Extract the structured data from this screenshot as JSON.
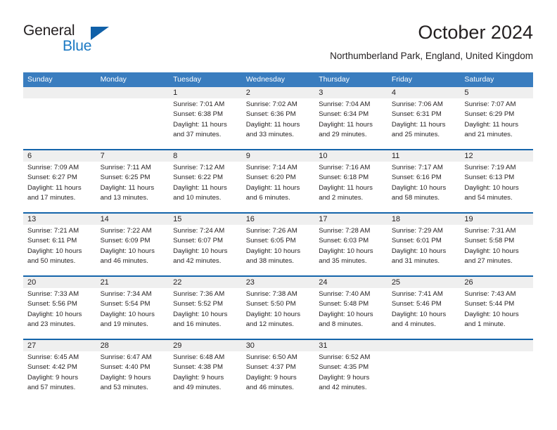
{
  "brand": {
    "name_part1": "General",
    "name_part2": "Blue",
    "accent_color": "#1b79c3",
    "triangle_color": "#1060a8"
  },
  "header": {
    "month_title": "October 2024",
    "location": "Northumberland Park, England, United Kingdom"
  },
  "theme": {
    "header_row_bg": "#3a7dbf",
    "week_separator": "#1565ab",
    "daynum_band_bg": "#efefef",
    "text_color": "#231f20"
  },
  "calendar": {
    "day_headers": [
      "Sunday",
      "Monday",
      "Tuesday",
      "Wednesday",
      "Thursday",
      "Friday",
      "Saturday"
    ],
    "weeks": [
      {
        "days": [
          {
            "num": "",
            "lines": [
              "",
              "",
              "",
              ""
            ],
            "empty": true
          },
          {
            "num": "",
            "lines": [
              "",
              "",
              "",
              ""
            ],
            "empty": true
          },
          {
            "num": "1",
            "lines": [
              "Sunrise: 7:01 AM",
              "Sunset: 6:38 PM",
              "Daylight: 11 hours",
              "and 37 minutes."
            ]
          },
          {
            "num": "2",
            "lines": [
              "Sunrise: 7:02 AM",
              "Sunset: 6:36 PM",
              "Daylight: 11 hours",
              "and 33 minutes."
            ]
          },
          {
            "num": "3",
            "lines": [
              "Sunrise: 7:04 AM",
              "Sunset: 6:34 PM",
              "Daylight: 11 hours",
              "and 29 minutes."
            ]
          },
          {
            "num": "4",
            "lines": [
              "Sunrise: 7:06 AM",
              "Sunset: 6:31 PM",
              "Daylight: 11 hours",
              "and 25 minutes."
            ]
          },
          {
            "num": "5",
            "lines": [
              "Sunrise: 7:07 AM",
              "Sunset: 6:29 PM",
              "Daylight: 11 hours",
              "and 21 minutes."
            ]
          }
        ]
      },
      {
        "days": [
          {
            "num": "6",
            "lines": [
              "Sunrise: 7:09 AM",
              "Sunset: 6:27 PM",
              "Daylight: 11 hours",
              "and 17 minutes."
            ]
          },
          {
            "num": "7",
            "lines": [
              "Sunrise: 7:11 AM",
              "Sunset: 6:25 PM",
              "Daylight: 11 hours",
              "and 13 minutes."
            ]
          },
          {
            "num": "8",
            "lines": [
              "Sunrise: 7:12 AM",
              "Sunset: 6:22 PM",
              "Daylight: 11 hours",
              "and 10 minutes."
            ]
          },
          {
            "num": "9",
            "lines": [
              "Sunrise: 7:14 AM",
              "Sunset: 6:20 PM",
              "Daylight: 11 hours",
              "and 6 minutes."
            ]
          },
          {
            "num": "10",
            "lines": [
              "Sunrise: 7:16 AM",
              "Sunset: 6:18 PM",
              "Daylight: 11 hours",
              "and 2 minutes."
            ]
          },
          {
            "num": "11",
            "lines": [
              "Sunrise: 7:17 AM",
              "Sunset: 6:16 PM",
              "Daylight: 10 hours",
              "and 58 minutes."
            ]
          },
          {
            "num": "12",
            "lines": [
              "Sunrise: 7:19 AM",
              "Sunset: 6:13 PM",
              "Daylight: 10 hours",
              "and 54 minutes."
            ]
          }
        ]
      },
      {
        "days": [
          {
            "num": "13",
            "lines": [
              "Sunrise: 7:21 AM",
              "Sunset: 6:11 PM",
              "Daylight: 10 hours",
              "and 50 minutes."
            ]
          },
          {
            "num": "14",
            "lines": [
              "Sunrise: 7:22 AM",
              "Sunset: 6:09 PM",
              "Daylight: 10 hours",
              "and 46 minutes."
            ]
          },
          {
            "num": "15",
            "lines": [
              "Sunrise: 7:24 AM",
              "Sunset: 6:07 PM",
              "Daylight: 10 hours",
              "and 42 minutes."
            ]
          },
          {
            "num": "16",
            "lines": [
              "Sunrise: 7:26 AM",
              "Sunset: 6:05 PM",
              "Daylight: 10 hours",
              "and 38 minutes."
            ]
          },
          {
            "num": "17",
            "lines": [
              "Sunrise: 7:28 AM",
              "Sunset: 6:03 PM",
              "Daylight: 10 hours",
              "and 35 minutes."
            ]
          },
          {
            "num": "18",
            "lines": [
              "Sunrise: 7:29 AM",
              "Sunset: 6:01 PM",
              "Daylight: 10 hours",
              "and 31 minutes."
            ]
          },
          {
            "num": "19",
            "lines": [
              "Sunrise: 7:31 AM",
              "Sunset: 5:58 PM",
              "Daylight: 10 hours",
              "and 27 minutes."
            ]
          }
        ]
      },
      {
        "days": [
          {
            "num": "20",
            "lines": [
              "Sunrise: 7:33 AM",
              "Sunset: 5:56 PM",
              "Daylight: 10 hours",
              "and 23 minutes."
            ]
          },
          {
            "num": "21",
            "lines": [
              "Sunrise: 7:34 AM",
              "Sunset: 5:54 PM",
              "Daylight: 10 hours",
              "and 19 minutes."
            ]
          },
          {
            "num": "22",
            "lines": [
              "Sunrise: 7:36 AM",
              "Sunset: 5:52 PM",
              "Daylight: 10 hours",
              "and 16 minutes."
            ]
          },
          {
            "num": "23",
            "lines": [
              "Sunrise: 7:38 AM",
              "Sunset: 5:50 PM",
              "Daylight: 10 hours",
              "and 12 minutes."
            ]
          },
          {
            "num": "24",
            "lines": [
              "Sunrise: 7:40 AM",
              "Sunset: 5:48 PM",
              "Daylight: 10 hours",
              "and 8 minutes."
            ]
          },
          {
            "num": "25",
            "lines": [
              "Sunrise: 7:41 AM",
              "Sunset: 5:46 PM",
              "Daylight: 10 hours",
              "and 4 minutes."
            ]
          },
          {
            "num": "26",
            "lines": [
              "Sunrise: 7:43 AM",
              "Sunset: 5:44 PM",
              "Daylight: 10 hours",
              "and 1 minute."
            ]
          }
        ]
      },
      {
        "days": [
          {
            "num": "27",
            "lines": [
              "Sunrise: 6:45 AM",
              "Sunset: 4:42 PM",
              "Daylight: 9 hours",
              "and 57 minutes."
            ]
          },
          {
            "num": "28",
            "lines": [
              "Sunrise: 6:47 AM",
              "Sunset: 4:40 PM",
              "Daylight: 9 hours",
              "and 53 minutes."
            ]
          },
          {
            "num": "29",
            "lines": [
              "Sunrise: 6:48 AM",
              "Sunset: 4:38 PM",
              "Daylight: 9 hours",
              "and 49 minutes."
            ]
          },
          {
            "num": "30",
            "lines": [
              "Sunrise: 6:50 AM",
              "Sunset: 4:37 PM",
              "Daylight: 9 hours",
              "and 46 minutes."
            ]
          },
          {
            "num": "31",
            "lines": [
              "Sunrise: 6:52 AM",
              "Sunset: 4:35 PM",
              "Daylight: 9 hours",
              "and 42 minutes."
            ]
          },
          {
            "num": "",
            "lines": [
              "",
              "",
              "",
              ""
            ],
            "empty": true
          },
          {
            "num": "",
            "lines": [
              "",
              "",
              "",
              ""
            ],
            "empty": true
          }
        ]
      }
    ]
  }
}
